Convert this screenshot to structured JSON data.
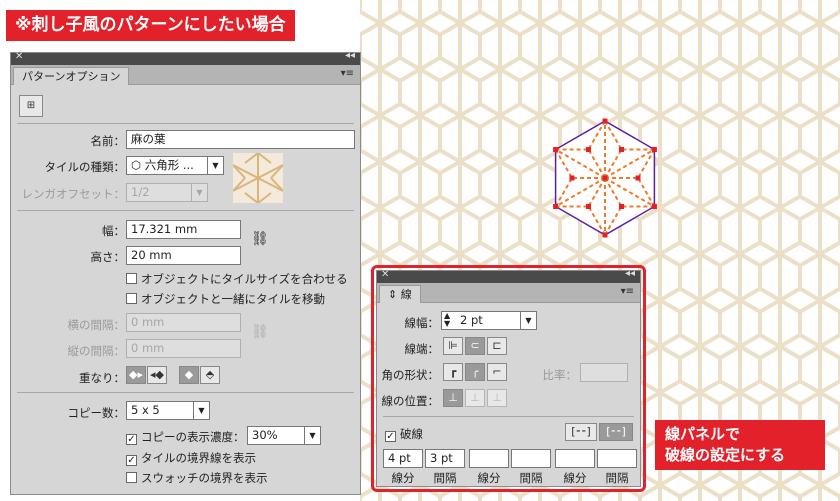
{
  "title_banner": "※刺し子風のパターンにしたい場合",
  "callout": {
    "line1": "線パネルで",
    "line2": "破線の設定にする"
  },
  "pattern_panel": {
    "tab": "パターンオプション",
    "name_label": "名前：",
    "name_value": "麻の葉",
    "tile_type_label": "タイルの種類：",
    "tile_type_value": "六角形 ...",
    "tile_type_icon": "hexagon-icon",
    "brick_offset_label": "レンガオフセット：",
    "brick_offset_value": "1/2",
    "width_label": "幅：",
    "width_value": "17.321 mm",
    "height_label": "高さ：",
    "height_value": "20 mm",
    "size_tile_to_art": "オブジェクトにタイルサイズを合わせる",
    "move_tile_with_art": "オブジェクトと一緒にタイルを移動",
    "h_spacing_label": "横の間隔：",
    "h_spacing_value": "0 mm",
    "v_spacing_label": "縦の間隔：",
    "v_spacing_value": "0 mm",
    "overlap_label": "重なり：",
    "copies_label": "コピー数：",
    "copies_value": "5 x 5",
    "dim_copies_label": "コピーの表示濃度：",
    "dim_copies_value": "30%",
    "dim_copies_checked": true,
    "show_tile_edge": "タイルの境界線を表示",
    "show_tile_edge_checked": true,
    "show_swatch_bounds": "スウォッチの境界を表示",
    "show_swatch_bounds_checked": false
  },
  "stroke_panel": {
    "tab": "線",
    "weight_label": "線幅：",
    "weight_value": "2 pt",
    "cap_label": "線端：",
    "corner_label": "角の形状：",
    "limit_label": "比率：",
    "align_label": "線の位置：",
    "dashed_label": "破線",
    "dashed_checked": true,
    "dash_values": [
      "4 pt",
      "3 pt",
      "",
      "",
      "",
      ""
    ],
    "dash_labels": [
      "線分",
      "間隔",
      "線分",
      "間隔",
      "線分",
      "間隔"
    ]
  },
  "colors": {
    "accent_red": "#e3212b",
    "pattern_beige": "#ecdfc7",
    "hexagon_stroke": "#5b1fa0",
    "leaf_orange": "#ef7b2a"
  }
}
